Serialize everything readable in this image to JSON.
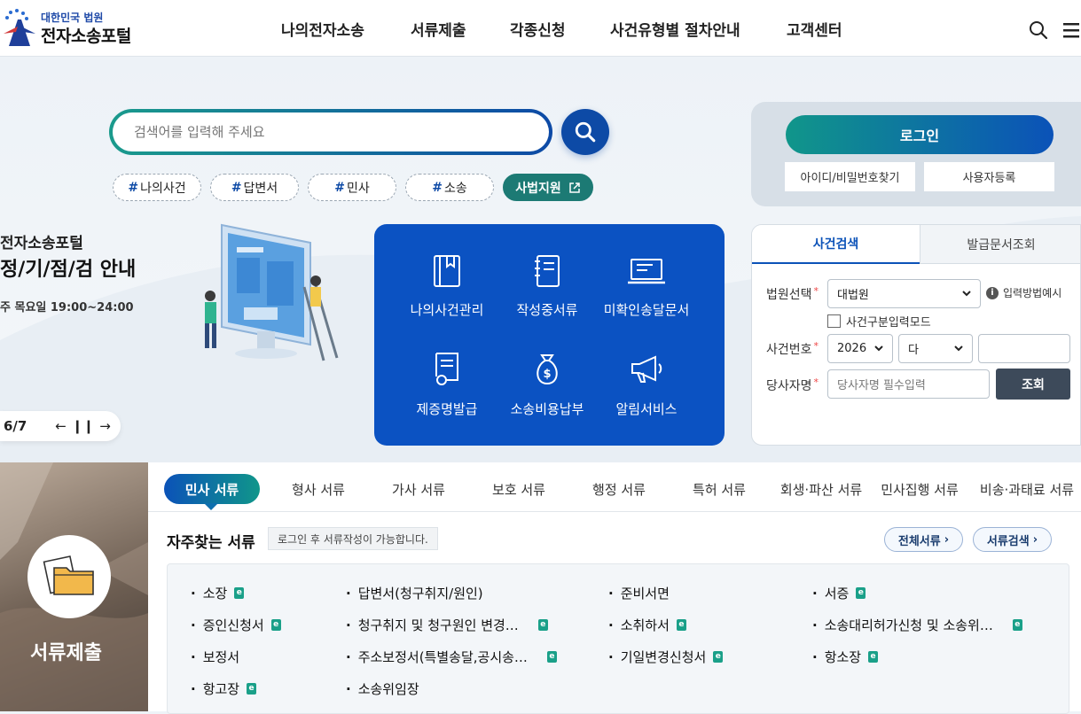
{
  "header": {
    "logo_small": "대한민국 법원",
    "logo_big": "전자소송포털",
    "nav": [
      "나의전자소송",
      "서류제출",
      "각종신청",
      "사건유형별 절차안내",
      "고객센터"
    ]
  },
  "search": {
    "placeholder": "검색어를 입력해 주세요",
    "tags": [
      "나의사건",
      "답변서",
      "민사",
      "소송"
    ],
    "tag_link": "사법지원"
  },
  "banner": {
    "line1": "전자소송포털",
    "line2": "정/기/점/검 안내",
    "line3": "주 목요일 19:00~24:00",
    "pager": "6/7"
  },
  "quick_menu": [
    "나의사건관리",
    "작성중서류",
    "미확인송달문서",
    "제증명발급",
    "소송비용납부",
    "알림서비스"
  ],
  "login": {
    "login_label": "로그인",
    "find_label": "아이디/비밀번호찾기",
    "register_label": "사용자등록"
  },
  "case_search": {
    "tabs": [
      "사건검색",
      "발급문서조회"
    ],
    "court_label": "법원선택",
    "court_value": "대법원",
    "input_help": "입력방법예시",
    "mode_label": "사건구분입력모드",
    "case_no_label": "사건번호",
    "year_value": "2026",
    "type_value": "다",
    "party_label": "당사자명",
    "party_placeholder": "당사자명 필수입력",
    "search_button": "조회"
  },
  "submit_block": {
    "title": "서류제출"
  },
  "doc_tabs": [
    "민사 서류",
    "형사 서류",
    "가사 서류",
    "보호 서류",
    "행정 서류",
    "특허 서류",
    "회생·파산 서류",
    "민사집행 서류",
    "비송·과태료 서류"
  ],
  "frequent": {
    "title": "자주찾는 서류",
    "note": "로그인 후 서류작성이 가능합니다.",
    "all_docs": "전체서류",
    "doc_search": "서류검색",
    "items": [
      {
        "label": "소장",
        "e": true
      },
      {
        "label": "답변서(청구취지/원인)",
        "e": false
      },
      {
        "label": "준비서면",
        "e": false
      },
      {
        "label": "서증",
        "e": true
      },
      {
        "label": "증인신청서",
        "e": true
      },
      {
        "label": "청구취지 및 청구원인 변경…",
        "e": true
      },
      {
        "label": "소취하서",
        "e": true
      },
      {
        "label": "소송대리허가신청 및 소송위…",
        "e": true
      },
      {
        "label": "보정서",
        "e": false
      },
      {
        "label": "주소보정서(특별송달,공시송…",
        "e": true
      },
      {
        "label": "기일변경신청서",
        "e": true
      },
      {
        "label": "항소장",
        "e": true
      },
      {
        "label": "항고장",
        "e": true
      },
      {
        "label": "소송위임장",
        "e": false
      }
    ]
  },
  "colors": {
    "primary": "#0b52b8",
    "teal": "#10968a",
    "quick_bg": "#0b52c2"
  }
}
